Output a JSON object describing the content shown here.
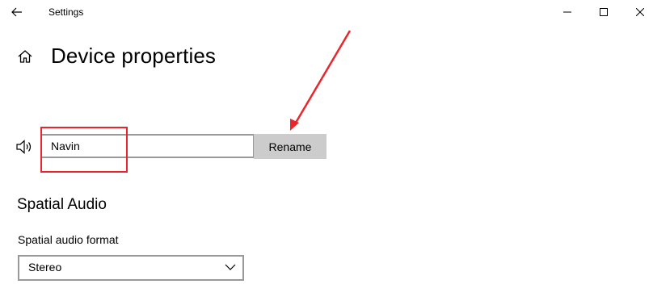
{
  "window": {
    "title": "Settings",
    "controls": {
      "minimize": "minimize-icon",
      "maximize": "maximize-icon",
      "close": "close-icon"
    }
  },
  "header": {
    "home_icon": "home-icon",
    "title": "Device properties"
  },
  "device": {
    "icon": "speaker-icon",
    "name_value": "Navin",
    "rename_label": "Rename"
  },
  "spatial_audio": {
    "title": "Spatial Audio",
    "format_label": "Spatial audio format",
    "format_selected": "Stereo"
  },
  "colors": {
    "annotation": "#e8262b",
    "button_bg": "#cccccc",
    "border": "#999999"
  }
}
